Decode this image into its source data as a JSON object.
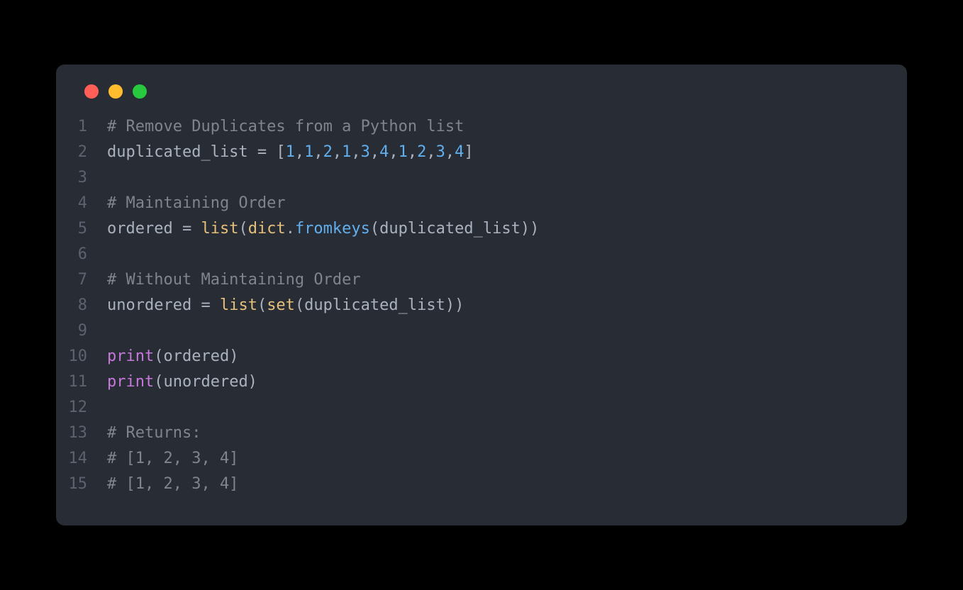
{
  "colors": {
    "bg": "#282c34",
    "red": "#ff5f56",
    "yellow": "#ffbd2e",
    "green": "#27c93f"
  },
  "code": {
    "lines": [
      {
        "num": "1",
        "tokens": [
          {
            "t": "# Remove Duplicates from a Python list",
            "c": "tok-comment"
          }
        ]
      },
      {
        "num": "2",
        "tokens": [
          {
            "t": "duplicated_list ",
            "c": "tok-default"
          },
          {
            "t": "=",
            "c": "tok-operator"
          },
          {
            "t": " [",
            "c": "tok-punct"
          },
          {
            "t": "1",
            "c": "tok-number"
          },
          {
            "t": ",",
            "c": "tok-punct"
          },
          {
            "t": "1",
            "c": "tok-number"
          },
          {
            "t": ",",
            "c": "tok-punct"
          },
          {
            "t": "2",
            "c": "tok-number"
          },
          {
            "t": ",",
            "c": "tok-punct"
          },
          {
            "t": "1",
            "c": "tok-number"
          },
          {
            "t": ",",
            "c": "tok-punct"
          },
          {
            "t": "3",
            "c": "tok-number"
          },
          {
            "t": ",",
            "c": "tok-punct"
          },
          {
            "t": "4",
            "c": "tok-number"
          },
          {
            "t": ",",
            "c": "tok-punct"
          },
          {
            "t": "1",
            "c": "tok-number"
          },
          {
            "t": ",",
            "c": "tok-punct"
          },
          {
            "t": "2",
            "c": "tok-number"
          },
          {
            "t": ",",
            "c": "tok-punct"
          },
          {
            "t": "3",
            "c": "tok-number"
          },
          {
            "t": ",",
            "c": "tok-punct"
          },
          {
            "t": "4",
            "c": "tok-number"
          },
          {
            "t": "]",
            "c": "tok-punct"
          }
        ]
      },
      {
        "num": "3",
        "tokens": []
      },
      {
        "num": "4",
        "tokens": [
          {
            "t": "# Maintaining Order",
            "c": "tok-comment"
          }
        ]
      },
      {
        "num": "5",
        "tokens": [
          {
            "t": "ordered ",
            "c": "tok-default"
          },
          {
            "t": "=",
            "c": "tok-operator"
          },
          {
            "t": " ",
            "c": "tok-default"
          },
          {
            "t": "list",
            "c": "tok-builtin"
          },
          {
            "t": "(",
            "c": "tok-punct"
          },
          {
            "t": "dict",
            "c": "tok-builtin"
          },
          {
            "t": ".",
            "c": "tok-punct"
          },
          {
            "t": "fromkeys",
            "c": "tok-func"
          },
          {
            "t": "(duplicated_list))",
            "c": "tok-punct"
          }
        ]
      },
      {
        "num": "6",
        "tokens": []
      },
      {
        "num": "7",
        "tokens": [
          {
            "t": "# Without Maintaining Order",
            "c": "tok-comment"
          }
        ]
      },
      {
        "num": "8",
        "tokens": [
          {
            "t": "unordered ",
            "c": "tok-default"
          },
          {
            "t": "=",
            "c": "tok-operator"
          },
          {
            "t": " ",
            "c": "tok-default"
          },
          {
            "t": "list",
            "c": "tok-builtin"
          },
          {
            "t": "(",
            "c": "tok-punct"
          },
          {
            "t": "set",
            "c": "tok-builtin"
          },
          {
            "t": "(duplicated_list))",
            "c": "tok-punct"
          }
        ]
      },
      {
        "num": "9",
        "tokens": []
      },
      {
        "num": "10",
        "tokens": [
          {
            "t": "print",
            "c": "tok-call"
          },
          {
            "t": "(ordered)",
            "c": "tok-punct"
          }
        ]
      },
      {
        "num": "11",
        "tokens": [
          {
            "t": "print",
            "c": "tok-call"
          },
          {
            "t": "(unordered)",
            "c": "tok-punct"
          }
        ]
      },
      {
        "num": "12",
        "tokens": []
      },
      {
        "num": "13",
        "tokens": [
          {
            "t": "# Returns:",
            "c": "tok-comment"
          }
        ]
      },
      {
        "num": "14",
        "tokens": [
          {
            "t": "# [1, 2, 3, 4]",
            "c": "tok-comment"
          }
        ]
      },
      {
        "num": "15",
        "tokens": [
          {
            "t": "# [1, 2, 3, 4]",
            "c": "tok-comment"
          }
        ]
      }
    ]
  }
}
